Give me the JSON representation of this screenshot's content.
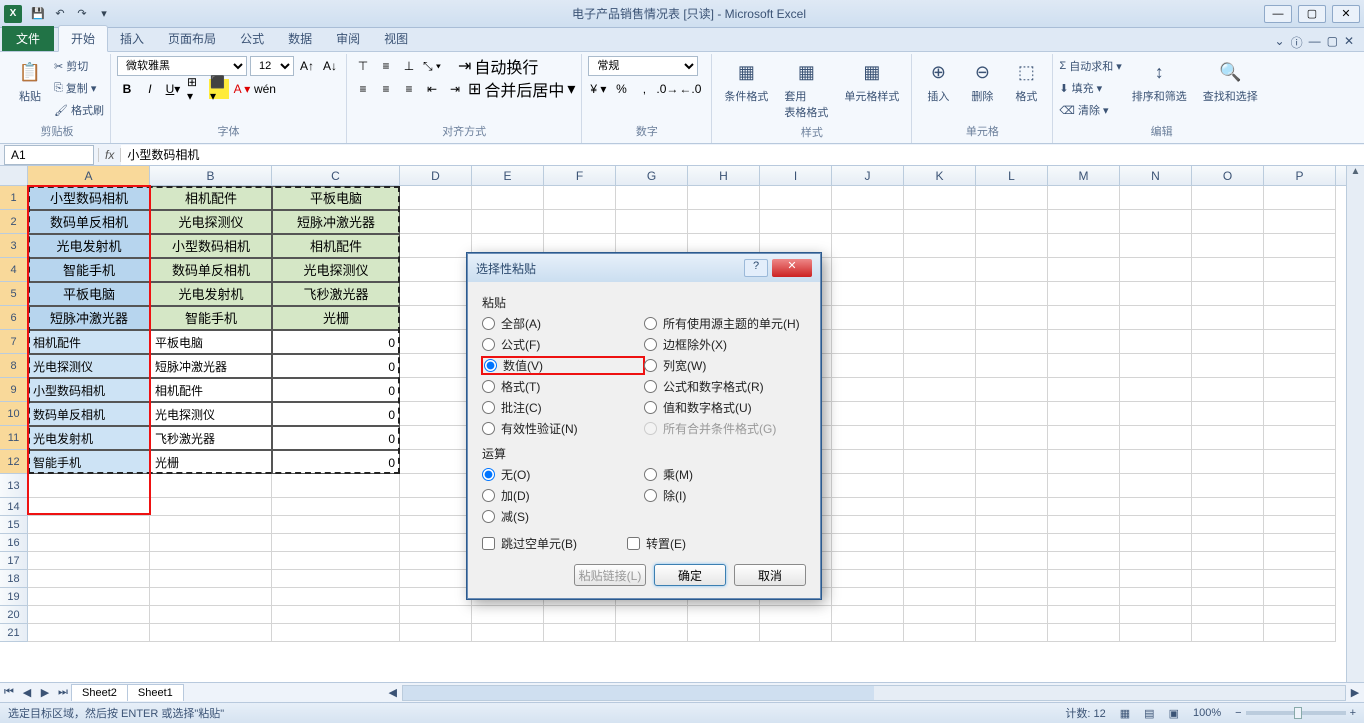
{
  "titlebar": {
    "title": "电子产品销售情况表  [只读] - Microsoft Excel"
  },
  "ribbon": {
    "file": "文件",
    "tabs": [
      "开始",
      "插入",
      "页面布局",
      "公式",
      "数据",
      "审阅",
      "视图"
    ],
    "active_tab": "开始",
    "clipboard": {
      "paste": "粘贴",
      "cut": "剪切",
      "copy": "复制",
      "format_painter": "格式刷",
      "label": "剪贴板"
    },
    "font": {
      "name": "微软雅黑",
      "size": "12",
      "label": "字体"
    },
    "alignment": {
      "wrap": "自动换行",
      "merge": "合并后居中",
      "label": "对齐方式"
    },
    "number": {
      "format": "常规",
      "label": "数字"
    },
    "styles": {
      "cond": "条件格式",
      "table": "套用\n表格格式",
      "cell": "单元格样式",
      "label": "样式"
    },
    "cells": {
      "insert": "插入",
      "delete": "删除",
      "format": "格式",
      "label": "单元格"
    },
    "editing": {
      "autosum": "自动求和",
      "fill": "填充",
      "clear": "清除",
      "sort": "排序和筛选",
      "find": "查找和选择",
      "label": "编辑"
    }
  },
  "formula_bar": {
    "name_box": "A1",
    "value": "小型数码相机"
  },
  "columns": [
    "A",
    "B",
    "C",
    "D",
    "E",
    "F",
    "G",
    "H",
    "I",
    "J",
    "K",
    "L",
    "M",
    "N",
    "O",
    "P"
  ],
  "grid": {
    "rows": [
      {
        "n": 1,
        "a": "小型数码相机",
        "b": "相机配件",
        "c": "平板电脑",
        "header": true
      },
      {
        "n": 2,
        "a": "数码单反相机",
        "b": "光电探测仪",
        "c": "短脉冲激光器"
      },
      {
        "n": 3,
        "a": "光电发射机",
        "b": "小型数码相机",
        "c": "相机配件"
      },
      {
        "n": 4,
        "a": "智能手机",
        "b": "数码单反相机",
        "c": "光电探测仪"
      },
      {
        "n": 5,
        "a": "平板电脑",
        "b": "光电发射机",
        "c": "飞秒激光器"
      },
      {
        "n": 6,
        "a": "短脉冲激光器",
        "b": "智能手机",
        "c": "光栅"
      },
      {
        "n": 7,
        "a": "相机配件",
        "b": "平板电脑",
        "c": "0",
        "plain": true
      },
      {
        "n": 8,
        "a": "光电探测仪",
        "b": "短脉冲激光器",
        "c": "0",
        "plain": true
      },
      {
        "n": 9,
        "a": "小型数码相机",
        "b": "相机配件",
        "c": "0",
        "plain": true
      },
      {
        "n": 10,
        "a": "数码单反相机",
        "b": "光电探测仪",
        "c": "0",
        "plain": true
      },
      {
        "n": 11,
        "a": "光电发射机",
        "b": "飞秒激光器",
        "c": "0",
        "plain": true
      },
      {
        "n": 12,
        "a": "智能手机",
        "b": "光栅",
        "c": "0",
        "plain": true
      }
    ],
    "empty_rows": [
      13,
      14,
      15,
      16,
      17,
      18,
      19,
      20,
      21
    ]
  },
  "dialog": {
    "title": "选择性粘贴",
    "section_paste": "粘贴",
    "paste_left": [
      {
        "label": "全部(A)",
        "key": "all"
      },
      {
        "label": "公式(F)",
        "key": "formulas"
      },
      {
        "label": "数值(V)",
        "key": "values",
        "checked": true,
        "highlight": true
      },
      {
        "label": "格式(T)",
        "key": "formats"
      },
      {
        "label": "批注(C)",
        "key": "comments"
      },
      {
        "label": "有效性验证(N)",
        "key": "validation"
      }
    ],
    "paste_right": [
      {
        "label": "所有使用源主题的单元(H)",
        "key": "theme"
      },
      {
        "label": "边框除外(X)",
        "key": "noborder"
      },
      {
        "label": "列宽(W)",
        "key": "colwidth"
      },
      {
        "label": "公式和数字格式(R)",
        "key": "formnumfmt"
      },
      {
        "label": "值和数字格式(U)",
        "key": "valnumfmt"
      },
      {
        "label": "所有合并条件格式(G)",
        "key": "mergecond",
        "disabled": true
      }
    ],
    "section_op": "运算",
    "op_left": [
      {
        "label": "无(O)",
        "key": "none",
        "checked": true
      },
      {
        "label": "加(D)",
        "key": "add"
      },
      {
        "label": "减(S)",
        "key": "sub"
      }
    ],
    "op_right": [
      {
        "label": "乘(M)",
        "key": "mul"
      },
      {
        "label": "除(I)",
        "key": "div"
      }
    ],
    "skip_blanks": "跳过空单元(B)",
    "transpose": "转置(E)",
    "paste_link": "粘贴链接(L)",
    "ok": "确定",
    "cancel": "取消"
  },
  "sheets": {
    "tabs": [
      "Sheet2",
      "Sheet1"
    ],
    "active": "Sheet2"
  },
  "status": {
    "msg": "选定目标区域，然后按 ENTER 或选择\"粘贴\"",
    "count_label": "计数:",
    "count": "12",
    "zoom": "100%"
  }
}
